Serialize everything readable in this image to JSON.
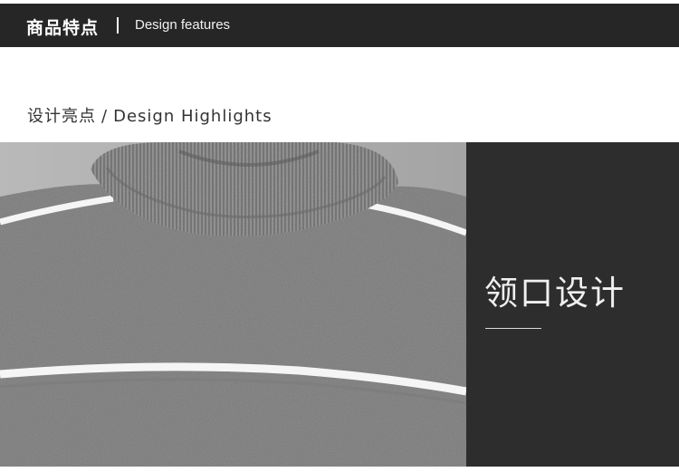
{
  "header": {
    "title_cn": "商品特点",
    "title_en": "Design features"
  },
  "section": {
    "title_cn": "设计亮点",
    "separator": "/",
    "title_en": "Design Highlights"
  },
  "feature": {
    "title": "领口设计"
  },
  "colors": {
    "header_bg": "#262626",
    "panel_bg": "#2d2d2d",
    "sweater_gray": "#8c8c8c",
    "stripe": "#f5f5f5"
  }
}
